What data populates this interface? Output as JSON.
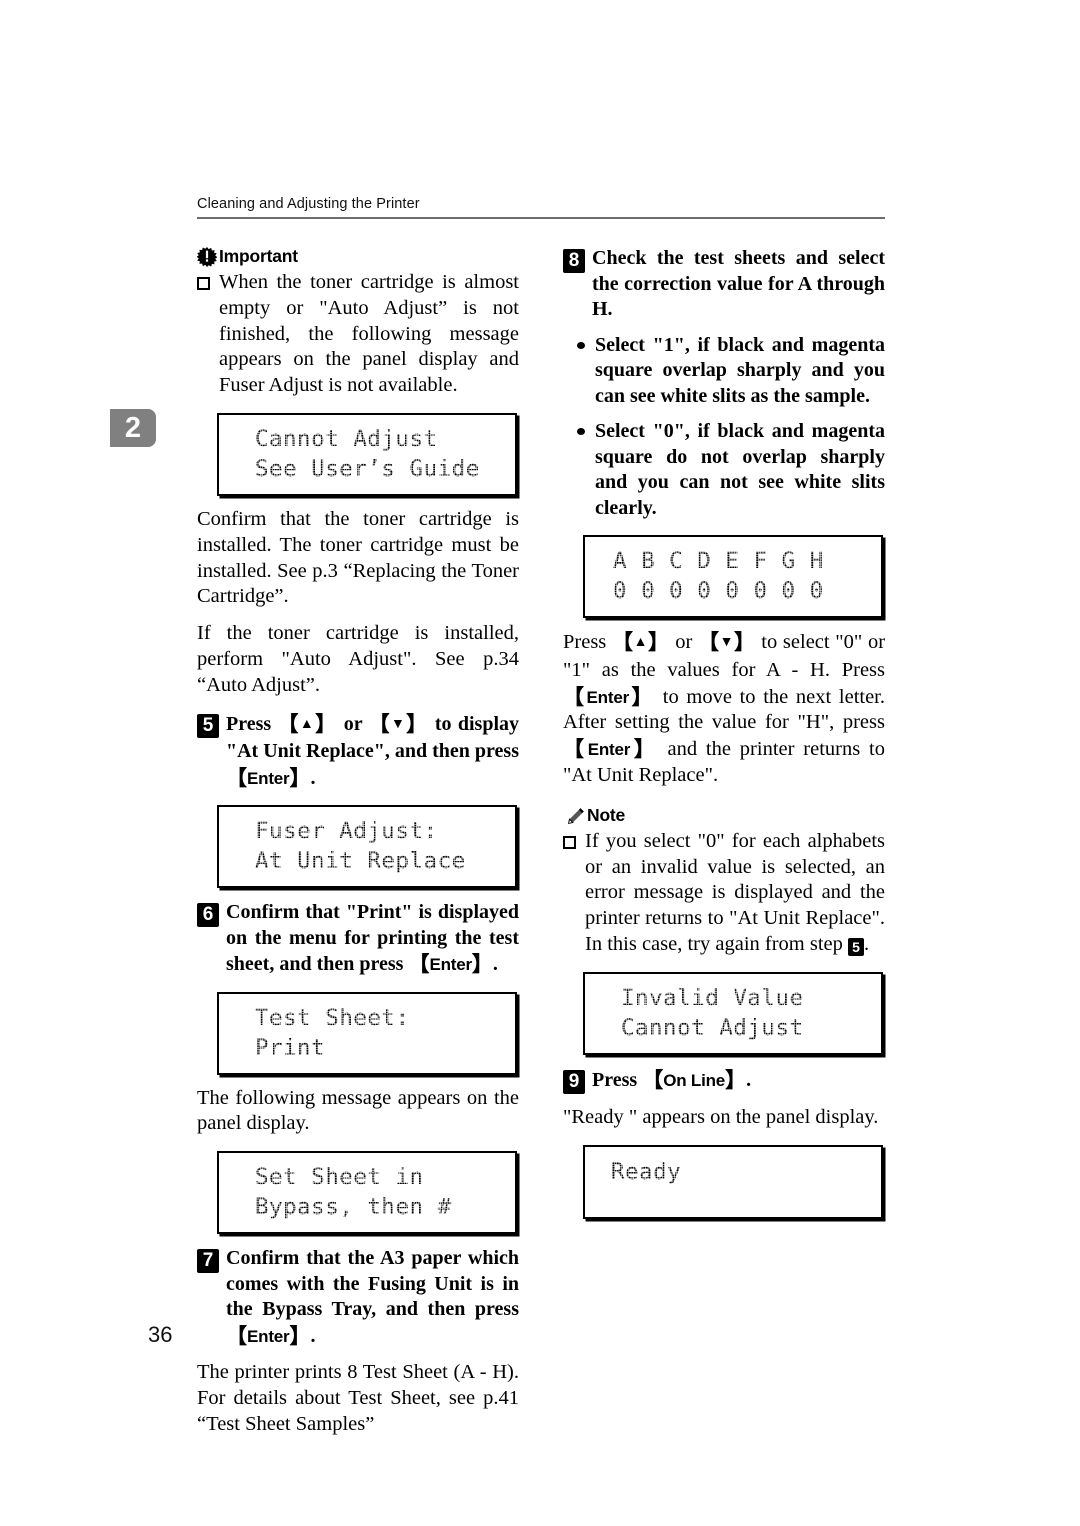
{
  "page": {
    "header_title": "Cleaning and Adjusting the Printer",
    "folio": "36",
    "chapter_tab": "2"
  },
  "left_column": {
    "important": {
      "icon": "important-sunburst-icon",
      "label": "Important",
      "items": [
        "When the toner cartridge is almost empty or \"Auto Adjust” is not finished, the following message appears on the panel display and Fuser Adjust is not available."
      ]
    },
    "lcd_cannot_adjust": {
      "line1": "Cannot Adjust",
      "line2": "See User’s Guide"
    },
    "para_confirm_toner": "Confirm that the toner cartridge is installed. The toner cartridge must be installed. See p.3 “Replacing the Toner Cartridge”.",
    "para_if_installed": "If the toner cartridge is installed, perform \"Auto Adjust\". See p.34 “Auto Adjust”.",
    "step5": {
      "number": "5",
      "text_a": "Press ",
      "key_up": "▲",
      "text_b": " or ",
      "key_down": "▼",
      "text_c": " to display \"At Unit Replace\", and then press ",
      "key_enter": "Enter",
      "text_d": "."
    },
    "lcd_fuser_adjust": {
      "line1": "Fuser Adjust:",
      "line2": "At Unit Replace"
    },
    "step6": {
      "number": "6",
      "text_a": "Confirm that \"Print\" is displayed on the menu for printing the test sheet, and then press ",
      "key_enter": "Enter",
      "text_b": "."
    },
    "lcd_test_sheet": {
      "line1": "Test Sheet:",
      "line2": "Print"
    },
    "para_following_message": "The following message appears on the panel display.",
    "lcd_set_sheet": {
      "line1": "Set Sheet in",
      "line2": "Bypass, then #"
    },
    "step7": {
      "number": "7",
      "text_a": "Confirm that the A3 paper which comes with the Fusing Unit is in the Bypass Tray, and then press ",
      "key_enter": "Enter",
      "text_b": "."
    },
    "para_printer_prints": "The printer prints 8 Test Sheet (A - H). For details about Test Sheet, see p.41 “Test Sheet Samples”"
  },
  "right_column": {
    "step8": {
      "number": "8",
      "text": "Check the test sheets and select the correction value for A through H.",
      "bullets": [
        "Select \"1\", if black and magenta square overlap sharply and you can see white slits as the sample.",
        "Select \"0\", if black and magenta square do not overlap sharply and you can not see white slits clearly."
      ]
    },
    "lcd_abcdefgh": {
      "line1": "A B C D E F G H",
      "line2": "0 0 0 0 0 0 0 0"
    },
    "para_press_updown": {
      "t1": "Press ",
      "key_up": "▲",
      "t2": " or ",
      "key_down": "▼",
      "t3": " to select \"0\" or \"1\" as the values for A - H. Press ",
      "key_enter_1": "Enter",
      "t4": " to move to the next letter. After setting the value for \"H\", press ",
      "key_enter_2": "Enter",
      "t5": " and the printer returns to \"At Unit Replace\"."
    },
    "note": {
      "icon": "note-pencil-icon",
      "label": "Note",
      "item_a": "If you select \"0\" for each alphabets or an invalid value is selected, an error message is displayed and the printer returns to \"At Unit Replace\". In this case, try again from step ",
      "item_step_ref": "5",
      "item_b": "."
    },
    "lcd_invalid_value": {
      "line1": "Invalid Value",
      "line2": "Cannot Adjust"
    },
    "step9": {
      "number": "9",
      "text_a": "Press ",
      "key_online": "On Line",
      "text_b": "."
    },
    "para_ready": "\"Ready \" appears on the panel display.",
    "lcd_ready": {
      "line1": "Ready"
    }
  },
  "colors": {
    "ink": "#000000",
    "paper": "#ffffff",
    "tab_gray": "#808080",
    "rule_gray": "#6d6d6d"
  }
}
